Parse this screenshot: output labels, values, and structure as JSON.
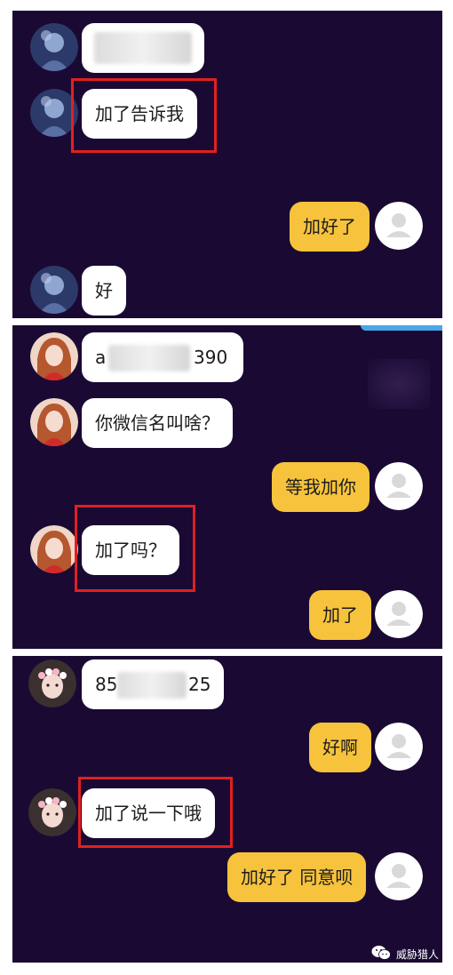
{
  "panels": [
    {
      "messages": [
        {
          "side": "in",
          "text": ""
        },
        {
          "side": "in",
          "text": "加了告诉我"
        },
        {
          "side": "out",
          "text": "加好了"
        },
        {
          "side": "in",
          "text": "好"
        }
      ]
    },
    {
      "messages": [
        {
          "side": "in",
          "text_left": "a",
          "text_right": "390"
        },
        {
          "side": "in",
          "text": "你微信名叫啥？"
        },
        {
          "side": "out",
          "text": "等我加你"
        },
        {
          "side": "in",
          "text": "加了吗？"
        },
        {
          "side": "out",
          "text": "加了"
        }
      ]
    },
    {
      "messages": [
        {
          "side": "in",
          "text_left": "85",
          "text_right": "25"
        },
        {
          "side": "out",
          "text": "好啊"
        },
        {
          "side": "in",
          "text": "加了说一下哦"
        },
        {
          "side": "out",
          "text": "加好了 同意呗"
        }
      ]
    }
  ],
  "watermark": {
    "text": "威胁猎人",
    "icon": "wechat-icon"
  },
  "colors": {
    "panel_bg": "#1a0a33",
    "incoming_bubble": "#ffffff",
    "outgoing_bubble": "#f7c33c",
    "highlight_box": "#e12020",
    "ribbon": "#4aa7e8"
  },
  "icons": {
    "avatar_placeholder": "user-placeholder-icon"
  }
}
